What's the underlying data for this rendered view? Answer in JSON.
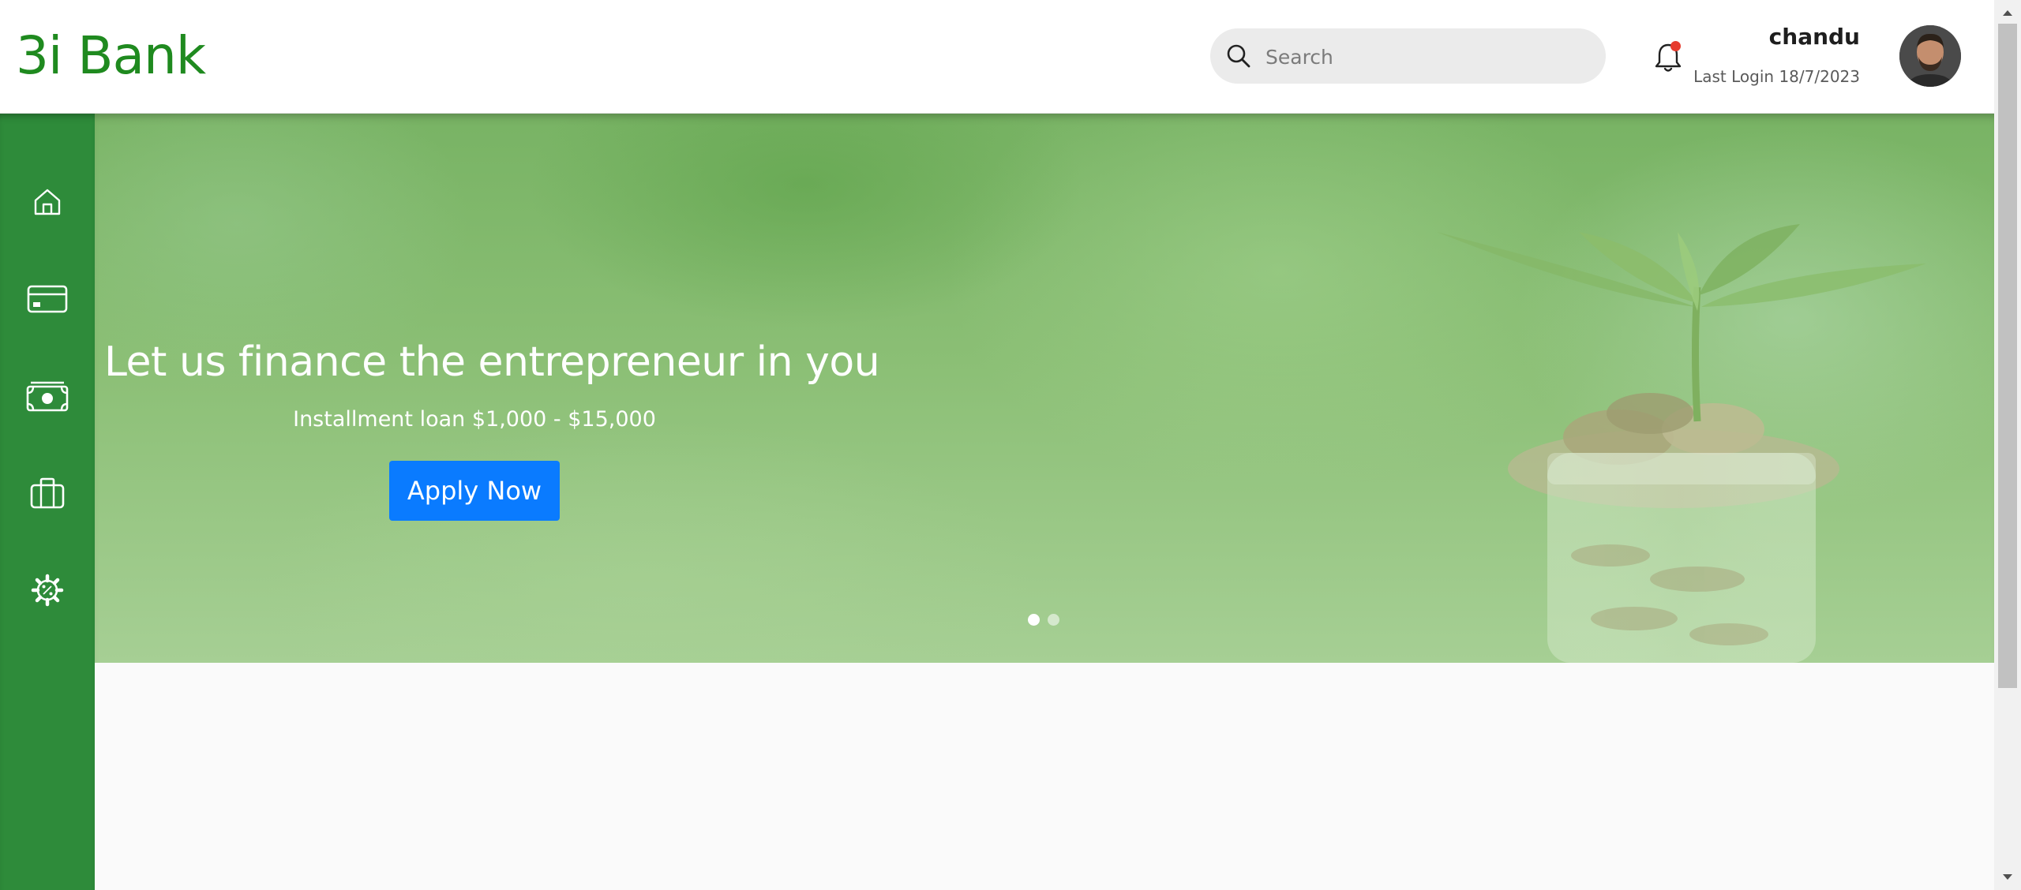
{
  "app": {
    "brand": "3i Bank"
  },
  "header": {
    "search_placeholder": "Search",
    "search_value": "",
    "user_name": "chandu",
    "last_login": "Last Login 18/7/2023"
  },
  "sidebar": {
    "items": [
      {
        "icon": "home-icon"
      },
      {
        "icon": "credit-card-icon"
      },
      {
        "icon": "cash-icon"
      },
      {
        "icon": "briefcase-icon"
      },
      {
        "icon": "percent-gear-icon"
      }
    ]
  },
  "hero": {
    "title": "Let us finance the entrepreneur in you",
    "subtitle": "Installment loan $1,000 - $15,000",
    "cta_label": "Apply Now",
    "slides_count": 2,
    "active_slide": 1
  },
  "colors": {
    "brand": "#1f8a1f",
    "sidebar": "#2e8b3a",
    "cta": "#0a7bff",
    "notification_dot": "#e63b2e"
  }
}
